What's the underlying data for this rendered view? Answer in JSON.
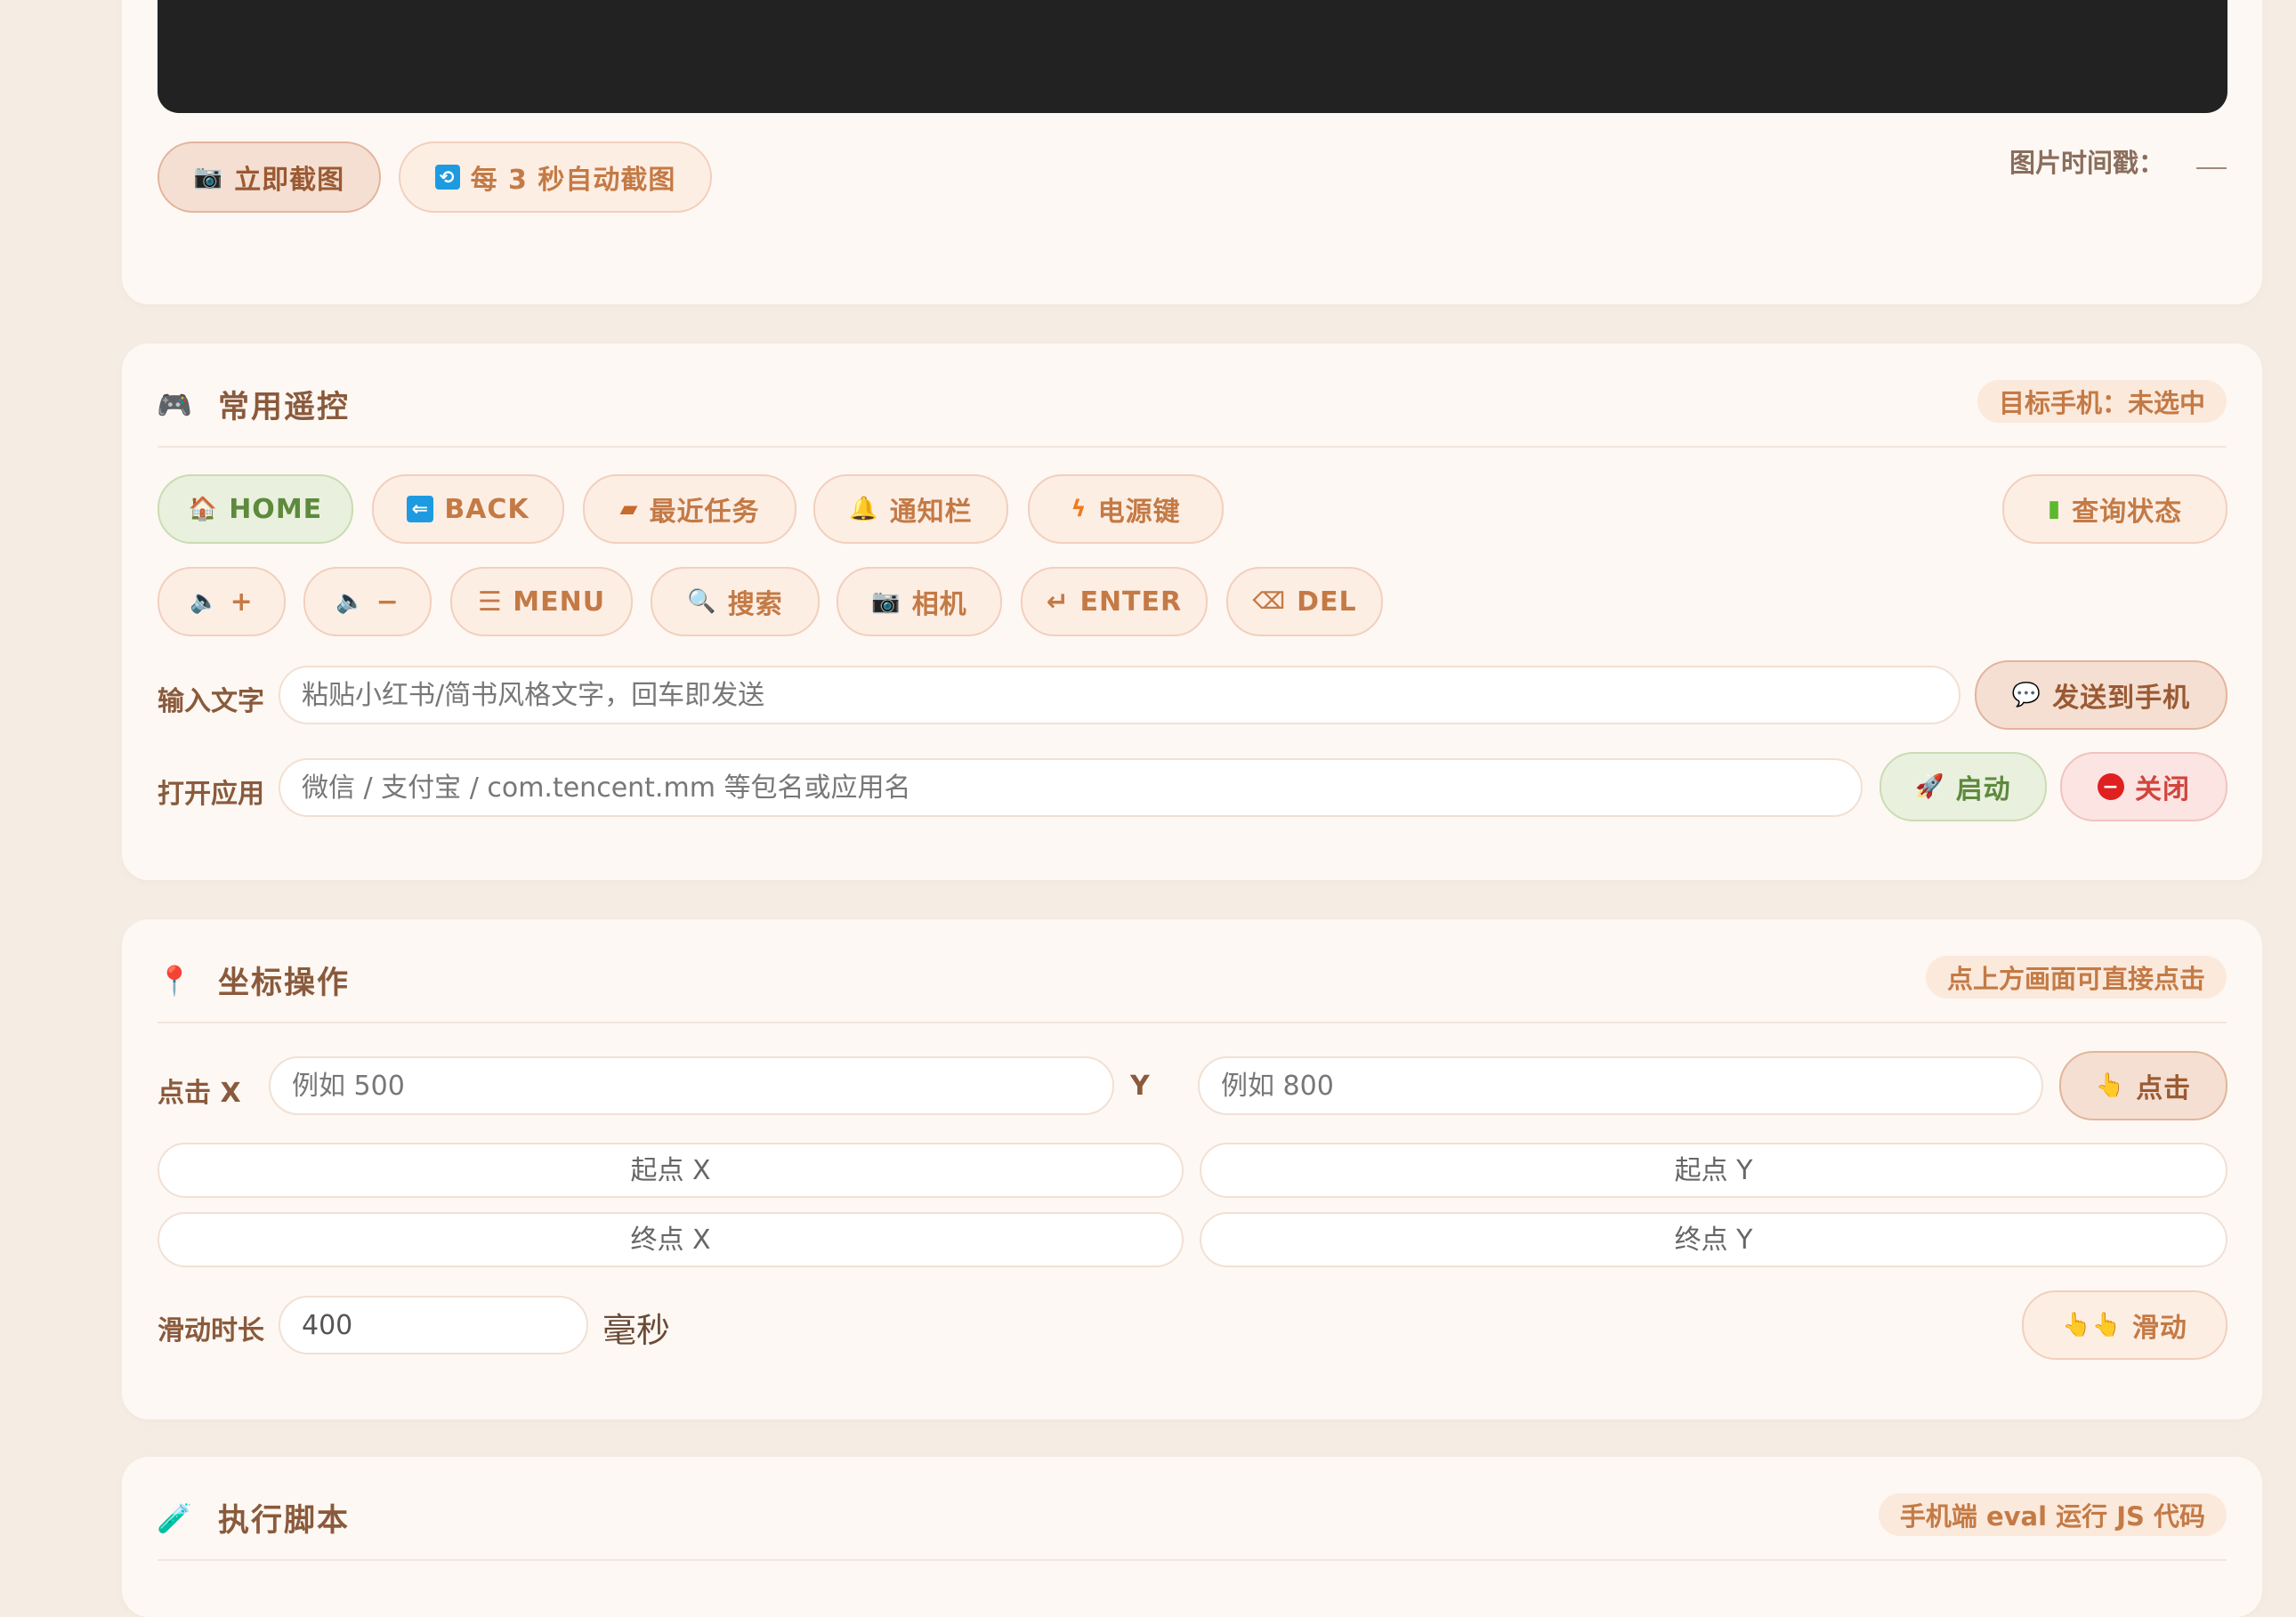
{
  "screenshot": {
    "capture_now_label": "立即截图",
    "auto_capture_label": "每 3 秒自动截图",
    "timestamp_label": "图片时间戳：",
    "timestamp_value": ""
  },
  "remote": {
    "title": "常用遥控",
    "badge": "目标手机：未选中",
    "row1": [
      {
        "icon": "house",
        "label": "HOME"
      },
      {
        "icon": "back-arrow",
        "label": "BACK"
      },
      {
        "icon": "folder",
        "label": "最近任务"
      },
      {
        "icon": "bell",
        "label": "通知栏"
      },
      {
        "icon": "lightning",
        "label": "电源键"
      }
    ],
    "status_label": "查询状态",
    "row2": [
      {
        "icon": "speaker",
        "label": "+"
      },
      {
        "icon": "speaker",
        "label": "−"
      },
      {
        "icon": "menu",
        "label": "☰ MENU"
      },
      {
        "icon": "magnifier",
        "label": "搜索"
      },
      {
        "icon": "camera",
        "label": "相机"
      },
      {
        "icon": "return",
        "label": "↵ ENTER"
      },
      {
        "icon": "backspace",
        "label": "DEL"
      }
    ],
    "text_input_label": "输入文字",
    "text_input_placeholder": "粘贴小红书/简书风格文字，回车即发送",
    "send_label": "发送到手机",
    "open_app_label": "打开应用",
    "open_app_placeholder": "微信 / 支付宝 / com.tencent.mm 等包名或应用名",
    "launch_label": "启动",
    "close_label": "关闭"
  },
  "coords": {
    "title": "坐标操作",
    "badge": "点上方画面可直接点击",
    "click_x_label": "点击 X",
    "click_x_placeholder": "例如 500",
    "click_y_label": "Y",
    "click_y_placeholder": "例如 800",
    "click_label": "点击",
    "start_x_placeholder": "起点 X",
    "start_y_placeholder": "起点 Y",
    "end_x_placeholder": "终点 X",
    "end_y_placeholder": "终点 Y",
    "duration_label": "滑动时长",
    "duration_value": "400",
    "duration_unit": "毫秒",
    "swipe_label": "滑动"
  },
  "script": {
    "title": "执行脚本",
    "badge": "手机端 eval 运行 JS 代码"
  }
}
